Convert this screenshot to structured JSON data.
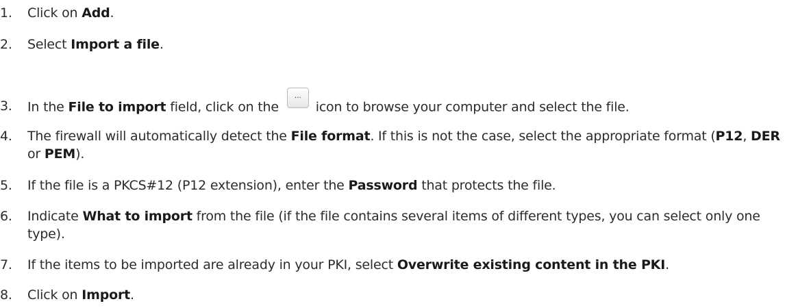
{
  "steps": [
    {
      "num": "1.",
      "parts": [
        {
          "t": "Click on "
        },
        {
          "t": "Add",
          "b": true
        },
        {
          "t": "."
        }
      ]
    },
    {
      "num": "2.",
      "parts": [
        {
          "t": "Select "
        },
        {
          "t": "Import a file",
          "b": true
        },
        {
          "t": "."
        }
      ]
    },
    {
      "num": "3.",
      "parts": [
        {
          "t": "In the "
        },
        {
          "t": "File to import",
          "b": true
        },
        {
          "t": " field, click on the "
        },
        {
          "icon": "browse-icon",
          "label": "..."
        },
        {
          "t": "icon to browse your computer and select the file."
        }
      ]
    },
    {
      "num": "4.",
      "parts": [
        {
          "t": "The firewall will automatically detect the "
        },
        {
          "t": "File format",
          "b": true
        },
        {
          "t": ". If this is not the case, select the appropriate format ("
        },
        {
          "t": "P12",
          "b": true
        },
        {
          "t": ", "
        },
        {
          "t": "DER",
          "b": true
        },
        {
          "t": " or "
        },
        {
          "t": "PEM",
          "b": true
        },
        {
          "t": ")."
        }
      ]
    },
    {
      "num": "5.",
      "parts": [
        {
          "t": "If the file is a PKCS#12 (P12 extension), enter the "
        },
        {
          "t": "Password",
          "b": true
        },
        {
          "t": " that protects the file."
        }
      ]
    },
    {
      "num": "6.",
      "parts": [
        {
          "t": "Indicate "
        },
        {
          "t": "What to import",
          "b": true
        },
        {
          "t": " from the file (if the file contains several items of different types, you can select only one type)."
        }
      ]
    },
    {
      "num": "7.",
      "parts": [
        {
          "t": "If the items to be imported are already in your PKI, select "
        },
        {
          "t": "Overwrite existing content in the PKI",
          "b": true
        },
        {
          "t": "."
        }
      ]
    },
    {
      "num": "8.",
      "parts": [
        {
          "t": "Click on "
        },
        {
          "t": "Import",
          "b": true
        },
        {
          "t": "."
        }
      ]
    }
  ]
}
